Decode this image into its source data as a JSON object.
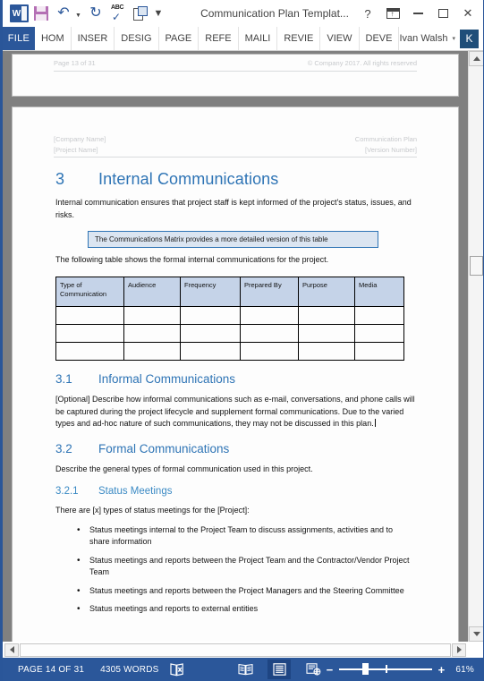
{
  "window": {
    "title": "Communication Plan Templat...",
    "quick_access": [
      {
        "name": "word-logo-icon",
        "label": "W"
      },
      {
        "name": "save-icon",
        "label": "Save"
      },
      {
        "name": "undo-icon",
        "label": "Undo"
      },
      {
        "name": "redo-icon",
        "label": "Redo"
      },
      {
        "name": "spelling-grammar-icon",
        "label": "ABC"
      },
      {
        "name": "print-preview-icon",
        "label": "Print Preview"
      },
      {
        "name": "customize-qat-icon",
        "label": "Customize Quick Access Toolbar"
      }
    ],
    "controls": {
      "help": "?",
      "ribbon_display_options": "Ribbon Display Options",
      "minimize": "Minimize",
      "maximize": "Maximize",
      "close": "✕"
    }
  },
  "ribbon": {
    "file_tab": "FILE",
    "tabs": [
      "HOM",
      "INSER",
      "DESIG",
      "PAGE",
      "REFE",
      "MAILI",
      "REVIE",
      "VIEW",
      "DEVE"
    ],
    "account": {
      "name": "Ivan Walsh",
      "caret": "▾",
      "avatar_initial": "K"
    }
  },
  "document": {
    "previous_page": {
      "footer_left": "Page 13 of 31",
      "footer_right": "© Company 2017. All rights reserved"
    },
    "header": {
      "left_line1": "[Company Name]",
      "left_line2": "[Project Name]",
      "right_line1": "Communication Plan",
      "right_line2": "[Version Number]"
    },
    "heading1": {
      "number": "3",
      "text": "Internal Communications"
    },
    "intro_paragraph": "Internal communication ensures that project staff is kept informed of the project's status, issues, and risks.",
    "callout": "The Communications Matrix provides a more detailed version of this table",
    "table_intro": "The following table shows the formal internal communications for the project.",
    "table": {
      "columns": [
        "Type of Communication",
        "Audience",
        "Frequency",
        "Prepared By",
        "Purpose",
        "Media"
      ],
      "rows": [
        [
          "",
          "",
          "",
          "",
          "",
          ""
        ],
        [
          "",
          "",
          "",
          "",
          "",
          ""
        ],
        [
          "",
          "",
          "",
          "",
          "",
          ""
        ]
      ]
    },
    "section_3_1": {
      "number": "3.1",
      "title": "Informal Communications",
      "body": "[Optional] Describe how informal communications such as e-mail, conversations, and phone calls will be captured during the project lifecycle and supplement formal communications. Due to the varied types and ad-hoc nature of such communications, they may not be discussed in this plan."
    },
    "section_3_2": {
      "number": "3.2",
      "title": "Formal Communications",
      "body": "Describe the general types of formal communication used in this project."
    },
    "section_3_2_1": {
      "number": "3.2.1",
      "title": "Status Meetings",
      "body": "There are [x] types of status meetings for the [Project]:",
      "bullets": [
        "Status meetings internal to the Project Team to discuss assignments, activities and to share information",
        "Status meetings and reports between the Project Team and the Contractor/Vendor Project Team",
        "Status meetings and reports between the Project Managers and the Steering Committee",
        "Status meetings and reports to external entities"
      ]
    }
  },
  "statusbar": {
    "page_info": "PAGE 14 OF 31",
    "word_count": "4305 WORDS",
    "proofing_icon": "proofing-errors-icon",
    "views": [
      {
        "name": "read-mode-view-icon",
        "active": false
      },
      {
        "name": "print-layout-view-icon",
        "active": true
      },
      {
        "name": "web-layout-view-icon",
        "active": false
      }
    ],
    "zoom": {
      "minus": "−",
      "plus": "+",
      "percent": "61%"
    }
  },
  "colors": {
    "word_blue": "#2b579a",
    "heading_blue": "#2e74b5",
    "callout_fill": "#dbe5f1",
    "table_header_fill": "#c5d3e8",
    "canvas_gray": "#808080"
  }
}
